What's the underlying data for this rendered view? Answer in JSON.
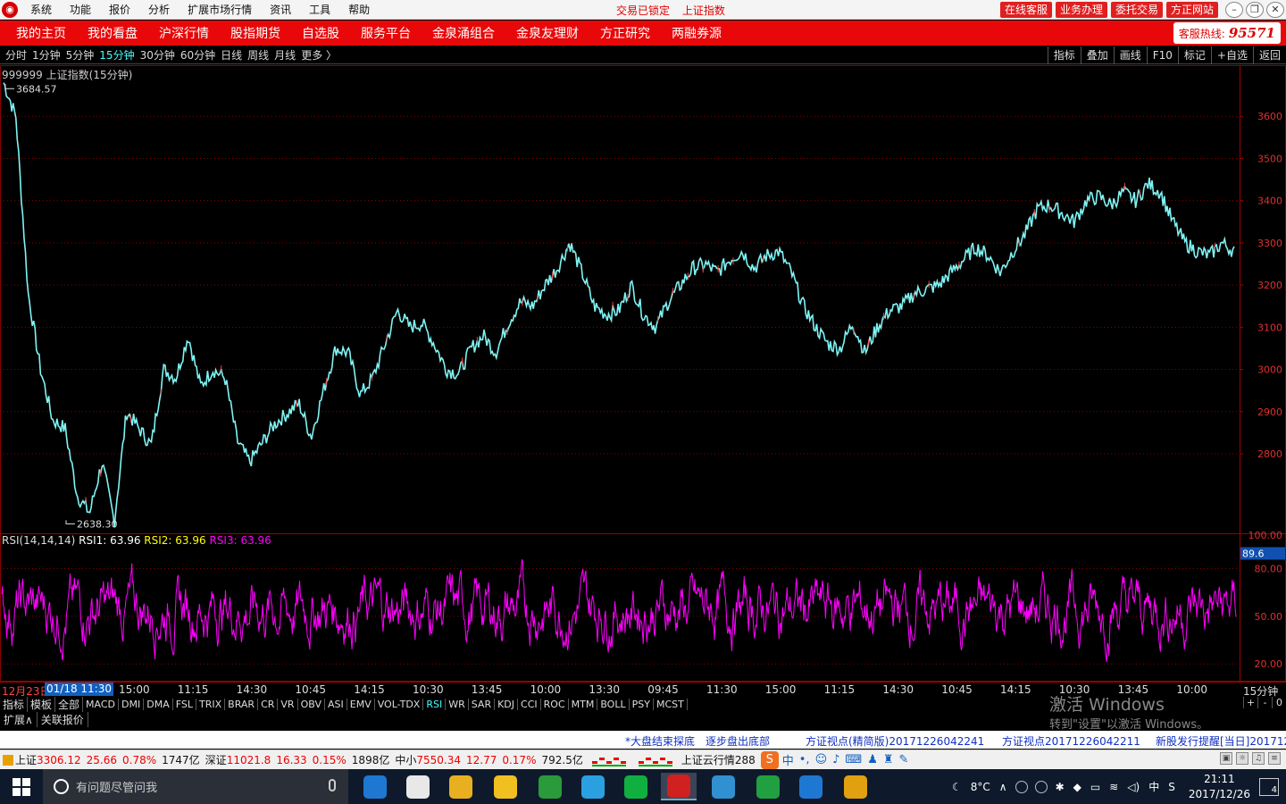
{
  "titlebar": {
    "menu": [
      "系统",
      "功能",
      "报价",
      "分析",
      "扩展市场行情",
      "资讯",
      "工具",
      "帮助"
    ],
    "status_lock": "交易已锁定",
    "status_index": "上证指数",
    "buttons": [
      "在线客服",
      "业务办理",
      "委托交易",
      "方正网站"
    ]
  },
  "nav": {
    "items": [
      "我的主页",
      "我的看盘",
      "沪深行情",
      "股指期货",
      "自选股",
      "服务平台",
      "金泉涌组合",
      "金泉友理财",
      "方正研究",
      "两融券源"
    ],
    "hotline_label": "客服热线:",
    "hotline_number": "95571"
  },
  "periods": {
    "items": [
      "分时",
      "1分钟",
      "5分钟",
      "15分钟",
      "30分钟",
      "60分钟",
      "日线",
      "周线",
      "月线",
      "更多 〉"
    ],
    "active": "15分钟"
  },
  "tools": [
    "指标",
    "叠加",
    "画线",
    "F10",
    "标记",
    "+自选",
    "返回"
  ],
  "main_chart": {
    "legend": "999999 上证指数(15分钟)",
    "high_label": "3684.57",
    "low_label": "2638.30"
  },
  "rsi": {
    "label": "RSI(14,14,14)",
    "rsi1": "RSI1: 63.96",
    "rsi2": "RSI2: 63.96",
    "rsi3": "RSI3: 63.96",
    "current_tag": "89.6"
  },
  "chart_data": {
    "type": "line",
    "price": {
      "yaxis_ticks": [
        2800,
        2900,
        3000,
        3100,
        3200,
        3300,
        3400,
        3500,
        3600
      ],
      "ylim": [
        2620,
        3700
      ],
      "high": 3684.57,
      "low": 2638.3,
      "path": [
        [
          0,
          3680
        ],
        [
          0.01,
          3600
        ],
        [
          0.02,
          3180
        ],
        [
          0.03,
          3000
        ],
        [
          0.04,
          2880
        ],
        [
          0.05,
          2860
        ],
        [
          0.06,
          2700
        ],
        [
          0.07,
          2660
        ],
        [
          0.08,
          2780
        ],
        [
          0.09,
          2640
        ],
        [
          0.1,
          2900
        ],
        [
          0.12,
          2820
        ],
        [
          0.13,
          3000
        ],
        [
          0.14,
          2980
        ],
        [
          0.15,
          3080
        ],
        [
          0.16,
          2960
        ],
        [
          0.17,
          3000
        ],
        [
          0.18,
          2980
        ],
        [
          0.19,
          2830
        ],
        [
          0.2,
          2780
        ],
        [
          0.22,
          2870
        ],
        [
          0.24,
          2920
        ],
        [
          0.25,
          2840
        ],
        [
          0.26,
          2950
        ],
        [
          0.27,
          3050
        ],
        [
          0.28,
          3040
        ],
        [
          0.29,
          2940
        ],
        [
          0.3,
          2980
        ],
        [
          0.31,
          3060
        ],
        [
          0.32,
          3140
        ],
        [
          0.33,
          3100
        ],
        [
          0.34,
          3110
        ],
        [
          0.35,
          3060
        ],
        [
          0.36,
          3000
        ],
        [
          0.37,
          2990
        ],
        [
          0.38,
          3050
        ],
        [
          0.39,
          3080
        ],
        [
          0.4,
          3040
        ],
        [
          0.41,
          3110
        ],
        [
          0.42,
          3160
        ],
        [
          0.43,
          3150
        ],
        [
          0.44,
          3200
        ],
        [
          0.45,
          3240
        ],
        [
          0.46,
          3300
        ],
        [
          0.47,
          3230
        ],
        [
          0.48,
          3150
        ],
        [
          0.49,
          3130
        ],
        [
          0.5,
          3140
        ],
        [
          0.51,
          3200
        ],
        [
          0.52,
          3130
        ],
        [
          0.53,
          3100
        ],
        [
          0.54,
          3160
        ],
        [
          0.55,
          3200
        ],
        [
          0.56,
          3240
        ],
        [
          0.57,
          3250
        ],
        [
          0.58,
          3230
        ],
        [
          0.59,
          3260
        ],
        [
          0.6,
          3280
        ],
        [
          0.61,
          3240
        ],
        [
          0.62,
          3270
        ],
        [
          0.63,
          3280
        ],
        [
          0.64,
          3230
        ],
        [
          0.65,
          3150
        ],
        [
          0.66,
          3100
        ],
        [
          0.67,
          3060
        ],
        [
          0.68,
          3050
        ],
        [
          0.69,
          3110
        ],
        [
          0.7,
          3040
        ],
        [
          0.71,
          3100
        ],
        [
          0.72,
          3140
        ],
        [
          0.73,
          3150
        ],
        [
          0.74,
          3180
        ],
        [
          0.75,
          3190
        ],
        [
          0.76,
          3200
        ],
        [
          0.77,
          3230
        ],
        [
          0.78,
          3260
        ],
        [
          0.79,
          3290
        ],
        [
          0.8,
          3270
        ],
        [
          0.81,
          3230
        ],
        [
          0.82,
          3280
        ],
        [
          0.83,
          3320
        ],
        [
          0.84,
          3380
        ],
        [
          0.85,
          3390
        ],
        [
          0.86,
          3370
        ],
        [
          0.87,
          3350
        ],
        [
          0.88,
          3400
        ],
        [
          0.89,
          3410
        ],
        [
          0.9,
          3390
        ],
        [
          0.91,
          3420
        ],
        [
          0.92,
          3400
        ],
        [
          0.93,
          3440
        ],
        [
          0.94,
          3420
        ],
        [
          0.95,
          3350
        ],
        [
          0.96,
          3300
        ],
        [
          0.97,
          3280
        ],
        [
          0.98,
          3270
        ],
        [
          0.99,
          3300
        ],
        [
          1.0,
          3280
        ]
      ]
    },
    "rsi": {
      "yaxis_ticks": [
        20,
        50,
        80
      ],
      "top_tick": "100.00",
      "ylim": [
        10,
        100
      ]
    },
    "x_time_labels": [
      "15:00",
      "11:15",
      "14:30",
      "10:45",
      "14:15",
      "10:30",
      "13:45",
      "10:00",
      "13:30",
      "09:45",
      "11:30",
      "15:00",
      "11:15",
      "14:30",
      "10:45",
      "14:15",
      "10:30",
      "13:45",
      "10:00"
    ],
    "x_first_label": "12月23日",
    "x_highlight_label": "01/18 11:30",
    "x_right_label": "15分钟"
  },
  "indicators": {
    "head": [
      "指标",
      "模板",
      "全部"
    ],
    "items": [
      "MACD",
      "DMI",
      "DMA",
      "FSL",
      "TRIX",
      "BRAR",
      "CR",
      "VR",
      "OBV",
      "ASI",
      "EMV",
      "VOL-TDX",
      "RSI",
      "WR",
      "SAR",
      "KDJ",
      "CCI",
      "ROC",
      "MTM",
      "BOLL",
      "PSY",
      "MCST"
    ],
    "active": "RSI",
    "right": [
      "+",
      "-",
      "0"
    ]
  },
  "ext": {
    "items": [
      "扩展∧",
      "关联报价"
    ]
  },
  "watermark": {
    "line1": "激活 Windows",
    "line2": "转到\"设置\"以激活 Windows。"
  },
  "news": [
    "*大盘结束探底",
    "逐步盘出底部",
    "方证视点(精简版)20171226042241",
    "方证视点20171226042211",
    "新股发行提醒[当日]201712"
  ],
  "status": {
    "sh_label": "上证",
    "sh_value": "3306.12",
    "sh_change": "25.66",
    "sh_pct": "0.78%",
    "sh_amount": "1747亿",
    "sz_label": "深证",
    "sz_value": "11021.8",
    "sz_change": "16.33",
    "sz_pct": "0.15%",
    "sz_amount": "1898亿",
    "zx_label": "中小",
    "zx_value": "7550.34",
    "zx_change": "12.77",
    "zx_pct": "0.17%",
    "zx_amount": "792.5亿",
    "cloud": "上证云行情288",
    "ime": "中"
  },
  "taskbar": {
    "search_placeholder": "有问题尽管问我",
    "temperature": "8°C",
    "input_method": "中",
    "time": "21:11",
    "date": "2017/12/26",
    "notifications": "4",
    "app_colors": [
      "#1e78d2",
      "#e8e8e8",
      "#e8b020",
      "#f0c020",
      "#2a9a3a",
      "#2aa0e0",
      "#10b040",
      "#d02020",
      "#3090d0",
      "#20a040",
      "#1e78d2",
      "#e0a010"
    ]
  },
  "colors": {
    "price_line": "#7ff4f4",
    "price_up": "#ff4040",
    "rsi_line": "#ff00ff",
    "grid": "#8a0000",
    "nav_red": "#e8080a"
  }
}
